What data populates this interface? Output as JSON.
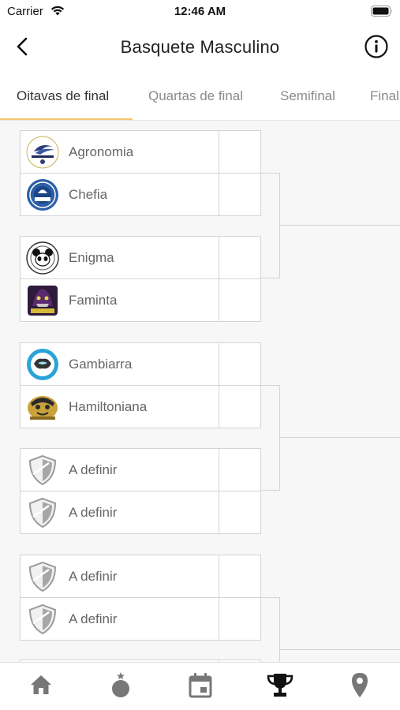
{
  "status_bar": {
    "carrier": "Carrier",
    "time": "12:46 AM"
  },
  "header": {
    "title": "Basquete Masculino"
  },
  "tabs": [
    {
      "label": "Oitavas de final",
      "active": true
    },
    {
      "label": "Quartas de final",
      "active": false
    },
    {
      "label": "Semifinal",
      "active": false
    },
    {
      "label": "Final",
      "active": false
    }
  ],
  "bracket": {
    "matches": [
      {
        "teams": [
          {
            "name": "Agronomia",
            "logo": "agronomia-logo-icon"
          },
          {
            "name": "Chefia",
            "logo": "chefia-logo-icon"
          }
        ]
      },
      {
        "teams": [
          {
            "name": "Enigma",
            "logo": "enigma-logo-icon"
          },
          {
            "name": "Faminta",
            "logo": "faminta-logo-icon"
          }
        ]
      },
      {
        "teams": [
          {
            "name": "Gambiarra",
            "logo": "gambiarra-logo-icon"
          },
          {
            "name": "Hamiltoniana",
            "logo": "hamiltoniana-logo-icon"
          }
        ]
      },
      {
        "teams": [
          {
            "name": "A definir",
            "logo": "shield-placeholder-icon"
          },
          {
            "name": "A definir",
            "logo": "shield-placeholder-icon"
          }
        ]
      },
      {
        "teams": [
          {
            "name": "A definir",
            "logo": "shield-placeholder-icon"
          },
          {
            "name": "A definir",
            "logo": "shield-placeholder-icon"
          }
        ]
      }
    ]
  },
  "tab_bar": [
    {
      "icon": "home-icon",
      "active": false
    },
    {
      "icon": "medal-icon",
      "active": false
    },
    {
      "icon": "calendar-icon",
      "active": false
    },
    {
      "icon": "trophy-icon",
      "active": true
    },
    {
      "icon": "location-pin-icon",
      "active": false
    }
  ],
  "colors": {
    "accent": "#f2c46d",
    "icon_inactive": "#777777",
    "icon_active": "#111111"
  }
}
